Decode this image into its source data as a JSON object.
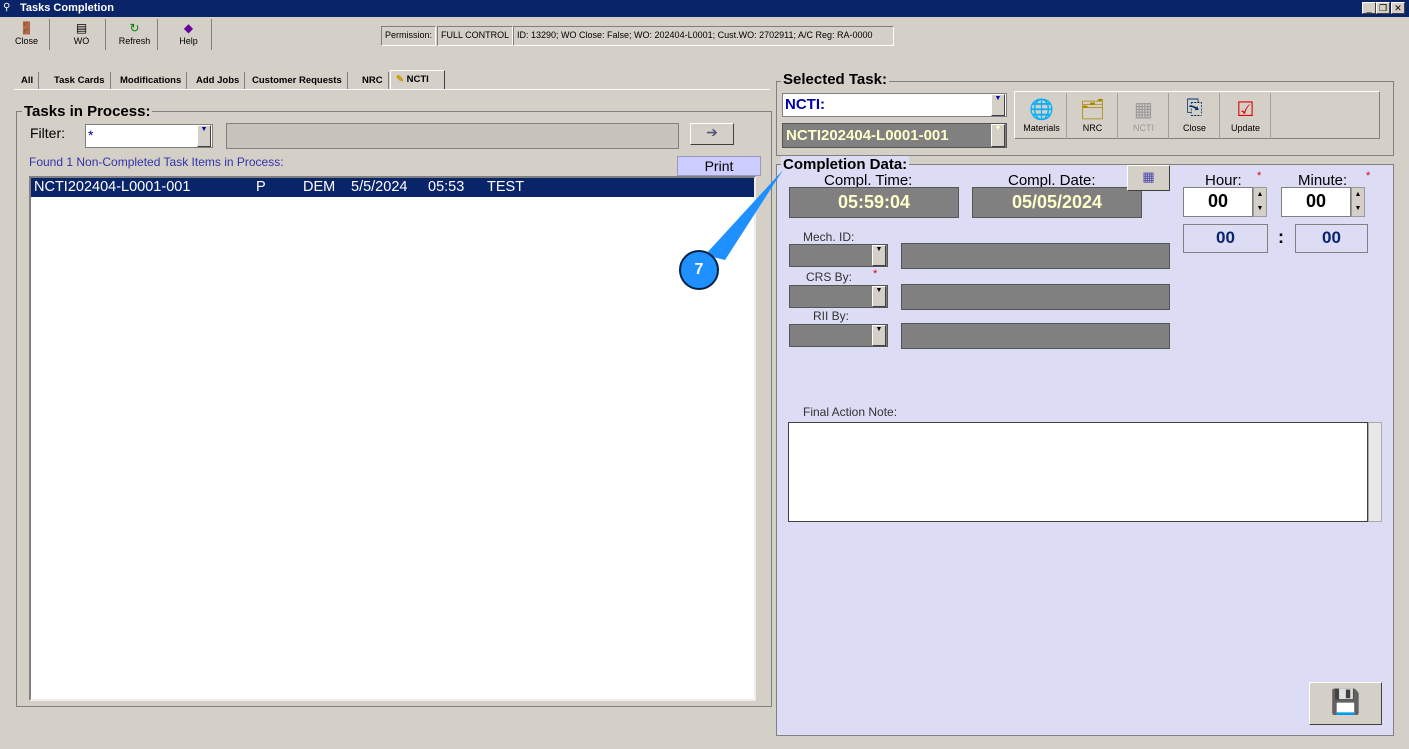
{
  "window": {
    "title": "Tasks Completion"
  },
  "toolbar": [
    {
      "label": "Close",
      "icon": "door-icon"
    },
    {
      "label": "WO",
      "icon": "document-icon"
    },
    {
      "label": "Refresh",
      "icon": "refresh-icon"
    },
    {
      "label": "Help",
      "icon": "help-book-icon"
    }
  ],
  "status": {
    "permission_label": "Permission:",
    "permission_value": "FULL CONTROL",
    "info": "ID: 13290; WO Close: False; WO: 202404-L0001; Cust.WO: 2702911; A/C Reg: RA-0000"
  },
  "tabs": [
    "All",
    "Task Cards",
    "Modifications",
    "Add Jobs",
    "Customer Requests",
    "NRC",
    "NCTI"
  ],
  "left": {
    "title": "Tasks in Process:",
    "filter_label": "Filter:",
    "filter_value": "*",
    "found_text": "Found 1 Non-Completed Task Items in Process:",
    "print_label": "Print",
    "rows": [
      {
        "id": "NCTI202404-L0001-001",
        "type": "P",
        "mech": "DEM",
        "date": "5/5/2024",
        "time": "05:53",
        "desc": "TEST"
      }
    ]
  },
  "selected": {
    "title": "Selected Task:",
    "type_value": "NCTI:",
    "task_value": "NCTI202404-L0001-001",
    "actions": [
      {
        "label": "Materials",
        "icon": "materials-globe-icon"
      },
      {
        "label": "NRC",
        "icon": "nrc-folder-icon"
      },
      {
        "label": "NCTI",
        "icon": "ncti-icon"
      },
      {
        "label": "Close",
        "icon": "close-task-icon"
      },
      {
        "label": "Update",
        "icon": "update-check-icon"
      }
    ]
  },
  "completion": {
    "title": "Completion Data:",
    "time_label": "Compl. Time:",
    "time_value": "05:59:04",
    "date_label": "Compl. Date:",
    "date_value": "05/05/2024",
    "hour_label": "Hour:",
    "minute_label": "Minute:",
    "hour_value": "00",
    "minute_value": "00",
    "hour_display": "00",
    "minute_display": "00",
    "colon": ":",
    "mech_label": "Mech. ID:",
    "crs_label": "CRS By:",
    "rii_label": "RII By:",
    "required": "*",
    "note_label": "Final Action Note:"
  },
  "callout": {
    "number": "7"
  }
}
